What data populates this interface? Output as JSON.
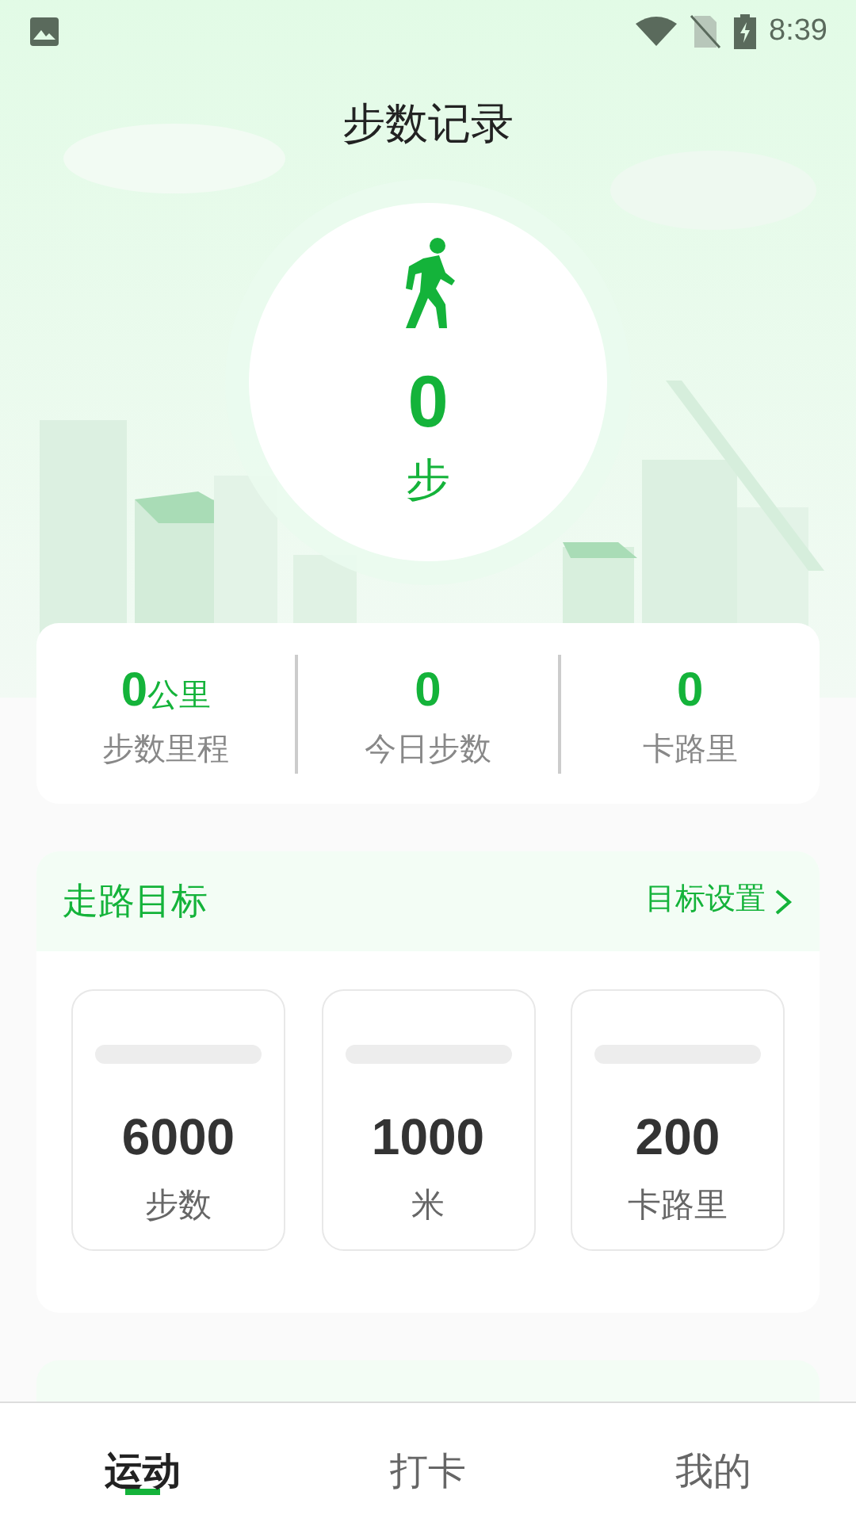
{
  "status_bar": {
    "time": "8:39"
  },
  "title": "步数记录",
  "steps": {
    "value": "0",
    "unit": "步"
  },
  "stats": [
    {
      "value": "0",
      "unit": "公里",
      "label": "步数里程"
    },
    {
      "value": "0",
      "label": "今日步数"
    },
    {
      "value": "0",
      "label": "卡路里"
    }
  ],
  "goal": {
    "title": "走路目标",
    "link": "目标设置",
    "items": [
      {
        "value": "6000",
        "label": "步数"
      },
      {
        "value": "1000",
        "label": "米"
      },
      {
        "value": "200",
        "label": "卡路里"
      }
    ]
  },
  "nav": [
    {
      "label": "运动",
      "selected": true
    },
    {
      "label": "打卡",
      "selected": false
    },
    {
      "label": "我的",
      "selected": false
    }
  ]
}
